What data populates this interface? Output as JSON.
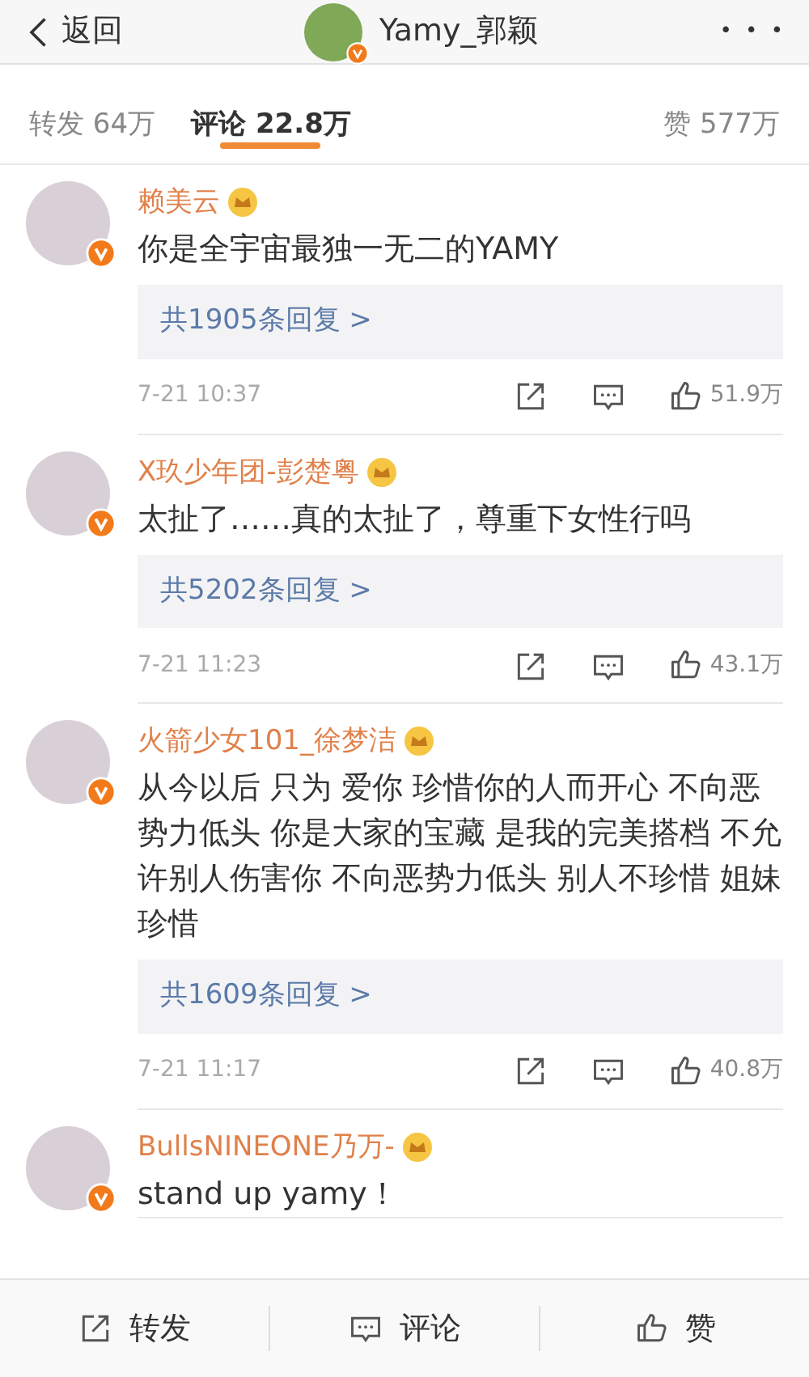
{
  "header": {
    "back_label": "返回",
    "title": "Yamy_郭颖",
    "more": "• • •"
  },
  "tabs": [
    {
      "label": "转发 64万",
      "selected": false
    },
    {
      "label": "评论 22.8万",
      "selected": true
    },
    {
      "label": "赞 577万",
      "selected": false
    }
  ],
  "comments": [
    {
      "name": "赖美云",
      "text": "你是全宇宙最独一无二的YAMY",
      "replies": "共1905条回复 >",
      "time": "7-21 10:37",
      "likes": "51.9万"
    },
    {
      "name": "X玖少年团-彭楚粤",
      "text": "太扯了……真的太扯了，尊重下女性行吗",
      "replies": "共5202条回复 >",
      "time": "7-21 11:23",
      "likes": "43.1万"
    },
    {
      "name": "火箭少女101_徐梦洁",
      "text": "从今以后 只为 爱你 珍惜你的人而开心 不向恶势力低头 你是大家的宝藏 是我的完美搭档 不允许别人伤害你 不向恶势力低头 别人不珍惜 姐妹珍惜",
      "replies": "共1609条回复 >",
      "time": "7-21 11:17",
      "likes": "40.8万"
    },
    {
      "name": "BullsNINEONE乃万-",
      "text": "stand up yamy！"
    }
  ],
  "bottom_bar": [
    {
      "kind": "share",
      "label": "转发"
    },
    {
      "kind": "comment",
      "label": "评论"
    },
    {
      "kind": "like",
      "label": "赞"
    }
  ]
}
